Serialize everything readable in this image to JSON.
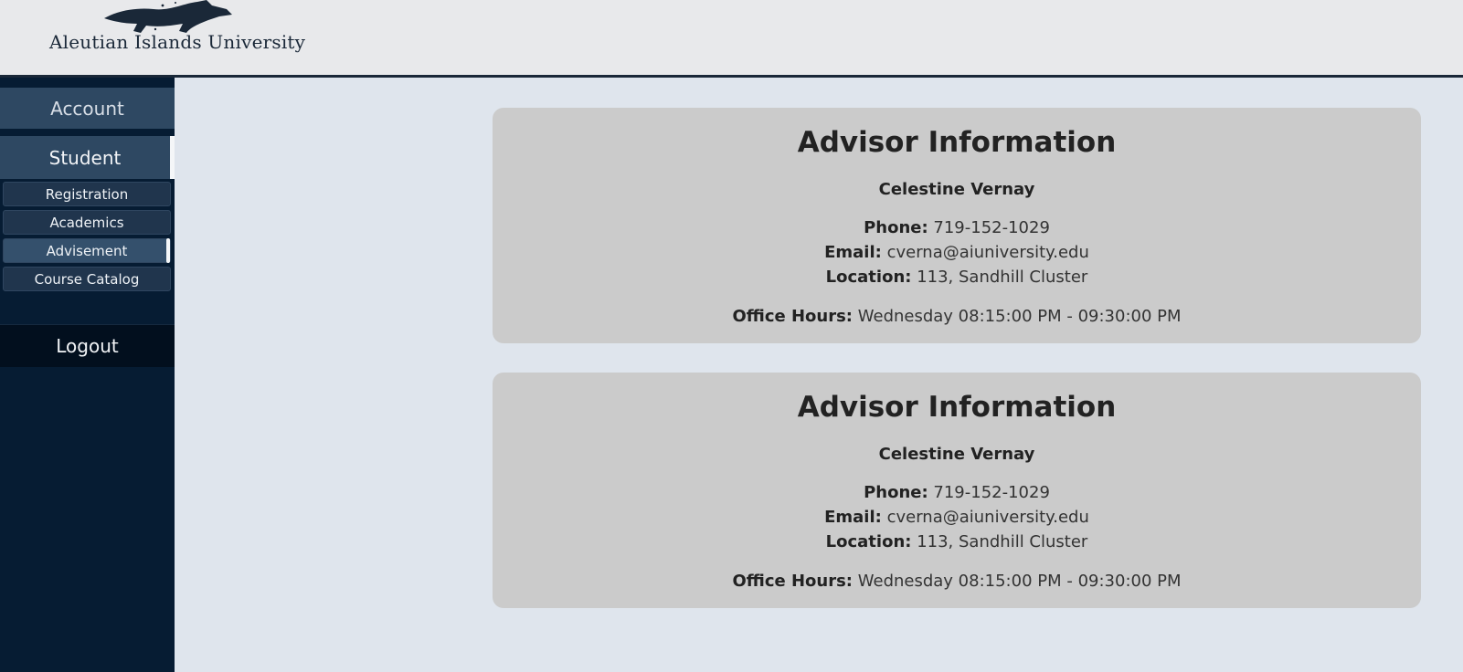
{
  "header": {
    "university_name": "Aleutian Islands University"
  },
  "sidebar": {
    "account_label": "Account",
    "student_label": "Student",
    "subitems": [
      {
        "label": "Registration"
      },
      {
        "label": "Academics"
      },
      {
        "label": "Advisement"
      },
      {
        "label": "Course Catalog"
      }
    ],
    "logout_label": "Logout"
  },
  "advisors": [
    {
      "heading": "Advisor Information",
      "name": "Celestine Vernay",
      "phone_label": "Phone:",
      "phone": "719-152-1029",
      "email_label": "Email:",
      "email": "cverna@aiuniversity.edu",
      "location_label": "Location:",
      "location": "113, Sandhill Cluster",
      "hours_label": "Office Hours:",
      "hours": "Wednesday 08:15:00 PM - 09:30:00 PM"
    },
    {
      "heading": "Advisor Information",
      "name": "Celestine Vernay",
      "phone_label": "Phone:",
      "phone": "719-152-1029",
      "email_label": "Email:",
      "email": "cverna@aiuniversity.edu",
      "location_label": "Location:",
      "location": "113, Sandhill Cluster",
      "hours_label": "Office Hours:",
      "hours": "Wednesday 08:15:00 PM - 09:30:00 PM"
    }
  ],
  "colors": {
    "sidebar_bg": "#061c33",
    "nav_item_bg": "#2e4862",
    "card_bg": "#cbcbcb",
    "page_bg": "#dfe5ed"
  },
  "icons": {
    "logo": "fox-logo-icon"
  }
}
